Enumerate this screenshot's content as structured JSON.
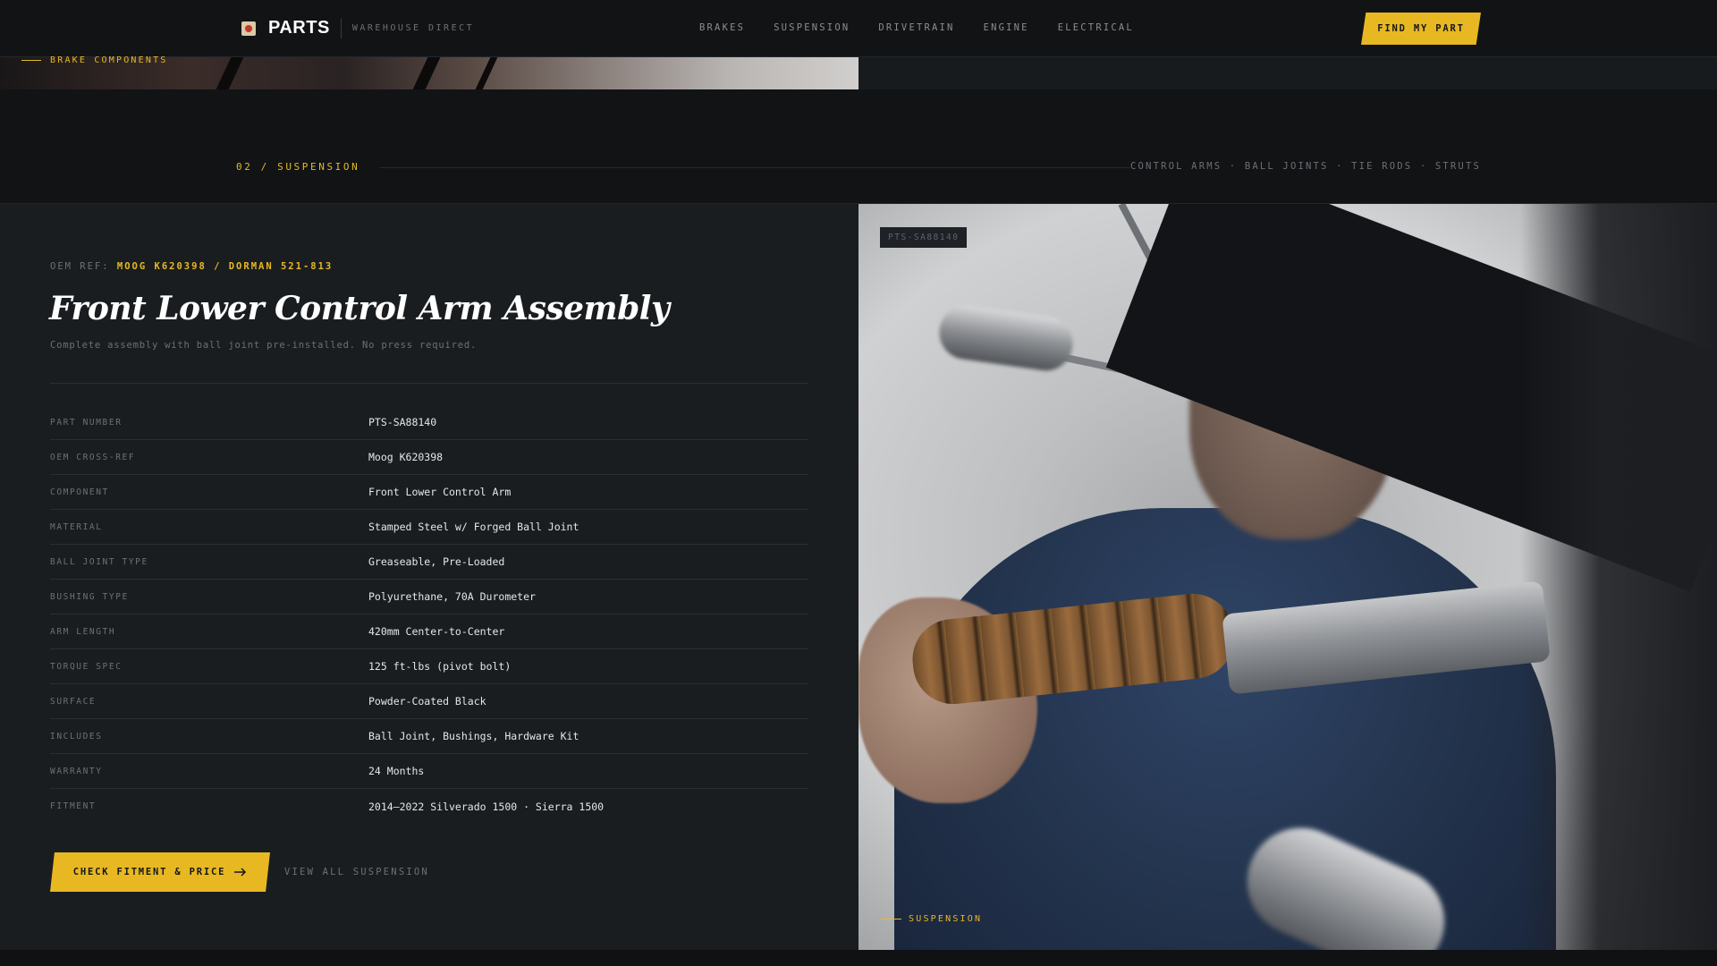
{
  "nav": {
    "logo_text": "PARTS",
    "logo_sub": "WAREHOUSE DIRECT",
    "links": [
      "BRAKES",
      "SUSPENSION",
      "DRIVETRAIN",
      "ENGINE",
      "ELECTRICAL"
    ],
    "cta_label": "FIND MY PART"
  },
  "previous_section": {
    "label": "BRAKE COMPONENTS"
  },
  "section": {
    "index_label": "02 / SUSPENSION",
    "tags": "CONTROL ARMS · BALL JOINTS · TIE RODS · STRUTS"
  },
  "product": {
    "oem_prefix": "OEM REF:",
    "oem_value": "MOOG K620398 / DORMAN 521-813",
    "title": "Front Lower Control Arm Assembly",
    "subtitle": "Complete assembly with ball joint pre-installed. No press required.",
    "specs": [
      {
        "key": "PART NUMBER",
        "value": "PTS-SA88140"
      },
      {
        "key": "OEM CROSS-REF",
        "value": "Moog K620398"
      },
      {
        "key": "COMPONENT",
        "value": "Front Lower Control Arm"
      },
      {
        "key": "MATERIAL",
        "value": "Stamped Steel w/ Forged Ball Joint"
      },
      {
        "key": "BALL JOINT TYPE",
        "value": "Greaseable, Pre-Loaded"
      },
      {
        "key": "BUSHING TYPE",
        "value": "Polyurethane, 70A Durometer"
      },
      {
        "key": "ARM LENGTH",
        "value": "420mm Center-to-Center"
      },
      {
        "key": "TORQUE SPEC",
        "value": "125 ft-lbs (pivot bolt)"
      },
      {
        "key": "SURFACE",
        "value": "Powder-Coated Black"
      },
      {
        "key": "INCLUDES",
        "value": "Ball Joint, Bushings, Hardware Kit"
      },
      {
        "key": "WARRANTY",
        "value": "24 Months"
      },
      {
        "key": "FITMENT",
        "value": "2014–2022 Silverado 1500 · Sierra 1500"
      }
    ],
    "cta_label": "CHECK FITMENT & PRICE",
    "secondary_label": "VIEW ALL SUSPENSION"
  },
  "photo": {
    "tag": "PTS-SA88140",
    "label": "SUSPENSION"
  },
  "colors": {
    "accent": "#e8b823",
    "background": "#111315",
    "panel": "#1a1d20",
    "muted_text": "#6c7076"
  },
  "icons": [
    "logo-icon",
    "arrow-right-icon"
  ]
}
